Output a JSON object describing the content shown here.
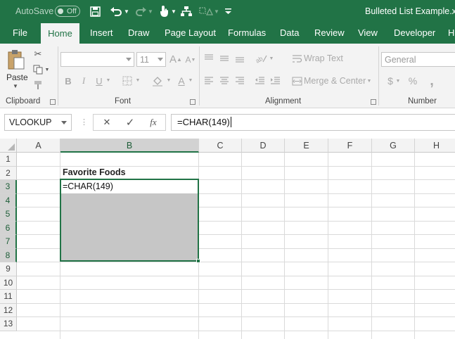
{
  "title_bar": {
    "autosave_label": "AutoSave",
    "autosave_state": "Off",
    "document_title": "Bulleted List Example.xlsx"
  },
  "tabs": [
    "File",
    "Home",
    "Insert",
    "Draw",
    "Page Layout",
    "Formulas",
    "Data",
    "Review",
    "View",
    "Developer",
    "H"
  ],
  "active_tab": "Home",
  "ribbon": {
    "clipboard": {
      "paste_label": "Paste",
      "group_label": "Clipboard"
    },
    "font": {
      "font_name": "",
      "font_size": "11",
      "group_label": "Font"
    },
    "alignment": {
      "wrap_text": "Wrap Text",
      "merge_center": "Merge & Center",
      "group_label": "Alignment"
    },
    "number": {
      "format": "General",
      "currency_symbol": "$",
      "percent_symbol": "%",
      "group_label": "Number"
    }
  },
  "formula_bar": {
    "name_box": "VLOOKUP",
    "cancel_symbol": "✕",
    "enter_symbol": "✓",
    "fx_label": "fx",
    "formula": "=CHAR(149)"
  },
  "sheet": {
    "columns": [
      "A",
      "B",
      "C",
      "D",
      "E",
      "F",
      "G",
      "H"
    ],
    "rows": [
      "1",
      "2",
      "3",
      "4",
      "5",
      "6",
      "7",
      "8",
      "9",
      "10",
      "11",
      "12",
      "13"
    ],
    "cells": {
      "B2": "Favorite Foods",
      "B3": "=CHAR(149)"
    },
    "selected_range": "B3:B8",
    "active_cell": "B3"
  },
  "colors": {
    "accent": "#217346",
    "selection": "#c6c6c6",
    "ribbon_bg": "#f3f3f3"
  }
}
